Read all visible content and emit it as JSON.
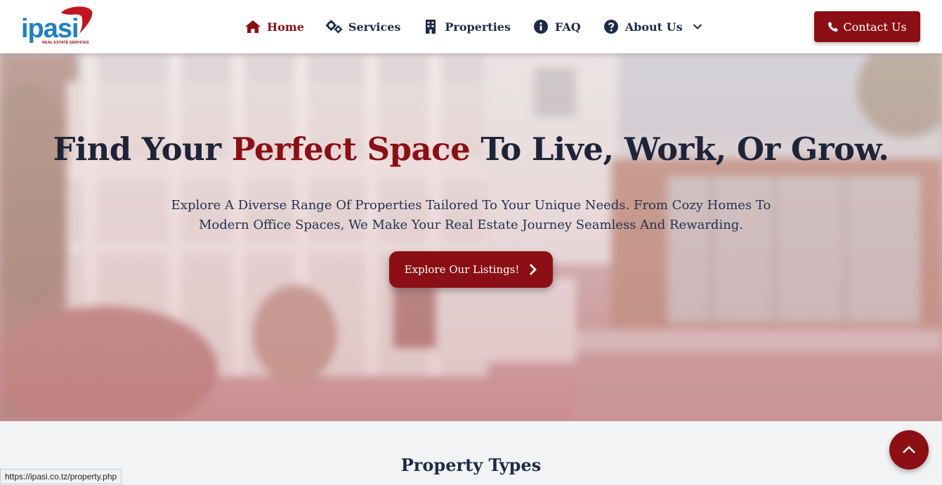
{
  "brand": {
    "name": "ipasi",
    "tagline": "REAL ESTATE SERVICES"
  },
  "nav": {
    "items": [
      {
        "label": "Home",
        "icon": "home-icon",
        "active": true
      },
      {
        "label": "Services",
        "icon": "gears-icon",
        "active": false
      },
      {
        "label": "Properties",
        "icon": "building-icon",
        "active": false
      },
      {
        "label": "FAQ",
        "icon": "info-circle-icon",
        "active": false
      },
      {
        "label": "About Us",
        "icon": "question-circle-icon",
        "active": false,
        "dropdown": true
      }
    ],
    "contact_label": "Contact Us"
  },
  "hero": {
    "title_before": "Find Your ",
    "title_accent": "Perfect Space",
    "title_after": " To Live, Work, Or Grow.",
    "subtitle": "Explore A Diverse Range Of Properties Tailored To Your Unique Needs. From Cozy Homes To Modern Office Spaces, We Make Your Real Estate Journey Seamless And Rewarding.",
    "cta_label": "Explore Our Listings!"
  },
  "section": {
    "title": "Property Types"
  },
  "status_bar": {
    "url": "https://ipasi.co.tz/property.php"
  },
  "colors": {
    "accent": "#8b0f14",
    "navy": "#1e2a47",
    "logo_blue": "#1f7fc4"
  }
}
